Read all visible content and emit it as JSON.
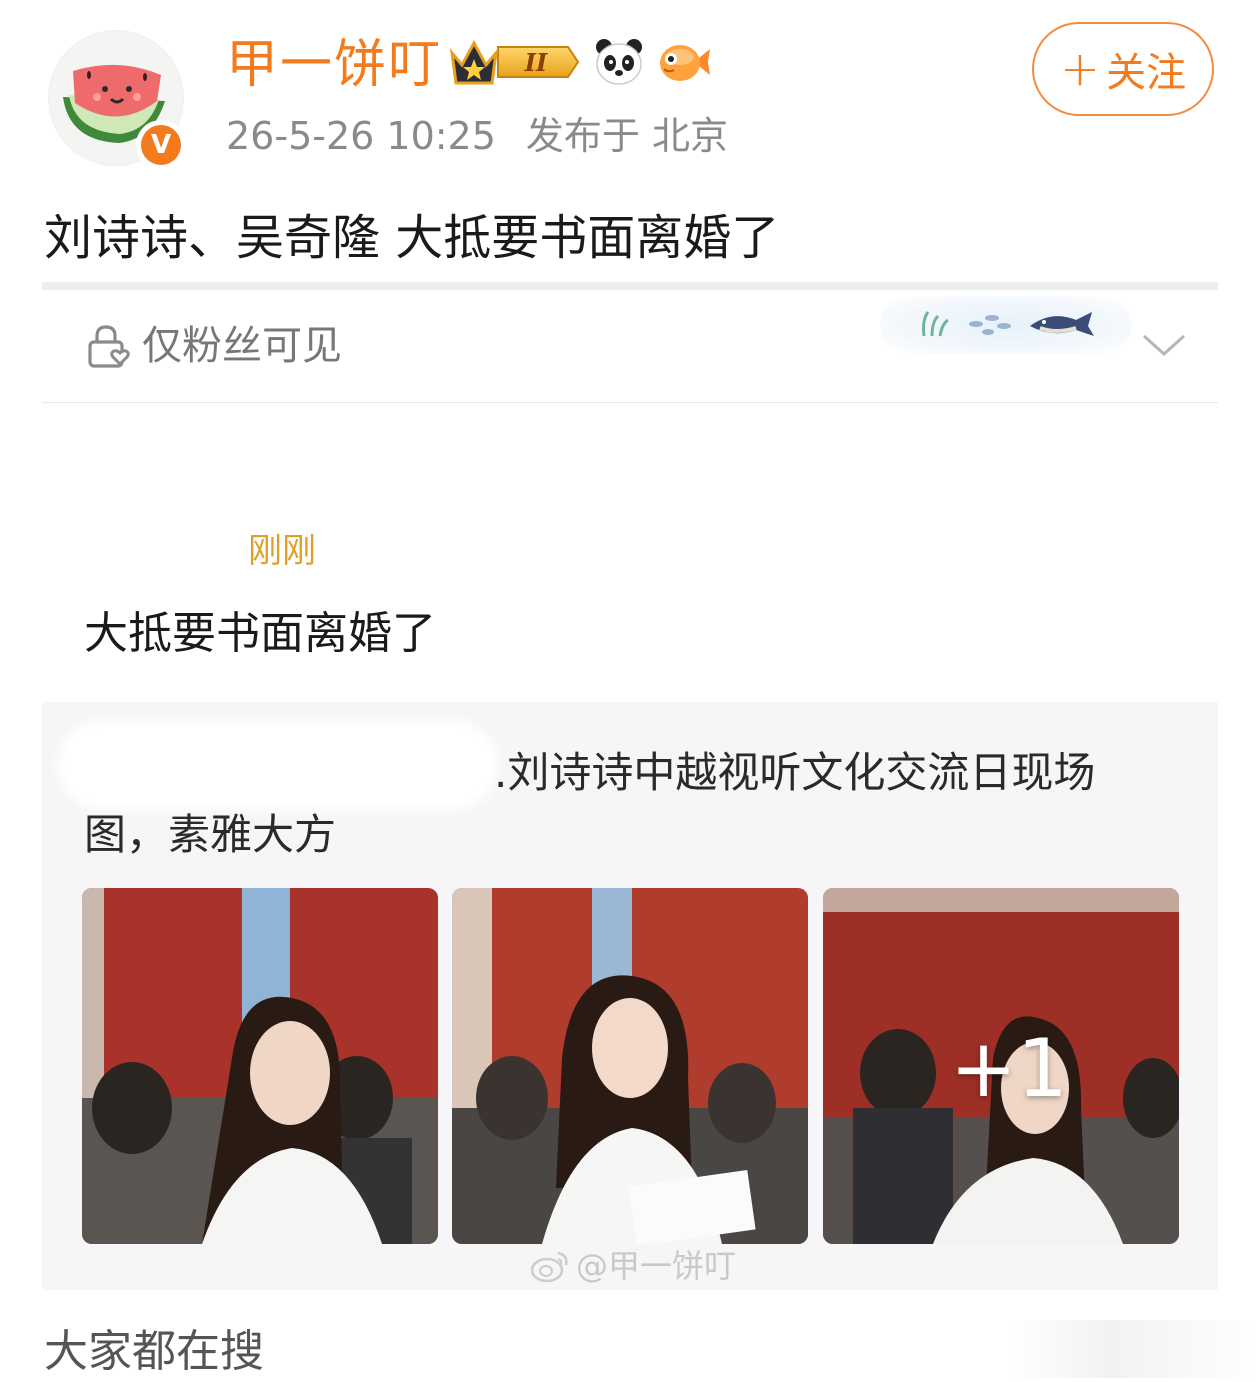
{
  "header": {
    "username": "甲一饼叮",
    "verified_mark": "V",
    "timestamp": "26-5-26 10:25",
    "location": "发布于 北京",
    "follow_label": "关注",
    "follow_plus": "+",
    "level_badge": "II"
  },
  "post": {
    "text": "刘诗诗、吴奇隆 大抵要书面离婚了"
  },
  "visibility": {
    "label": "仅粉丝可见"
  },
  "comment": {
    "time": "刚刚",
    "text": "大抵要书面离婚了"
  },
  "quote": {
    "line1": ".刘诗诗中越视听文化交流日现场",
    "line2": "图，素雅大方",
    "more_count": "+1",
    "watermark": "@甲一饼叮"
  },
  "section": {
    "title": "大家都在搜"
  },
  "colors": {
    "accent_orange": "#f37b1d",
    "time_gold": "#e0a02a",
    "meta_gray": "#8a8a8a"
  },
  "icons": {
    "avatar": "watermelon-avatar",
    "badges": [
      "crown-level-badge",
      "panda-icon",
      "goldfish-icon"
    ],
    "lock": "lock-heart-icon",
    "chevron": "chevron-down-icon",
    "watermark": "weibo-logo-icon"
  }
}
